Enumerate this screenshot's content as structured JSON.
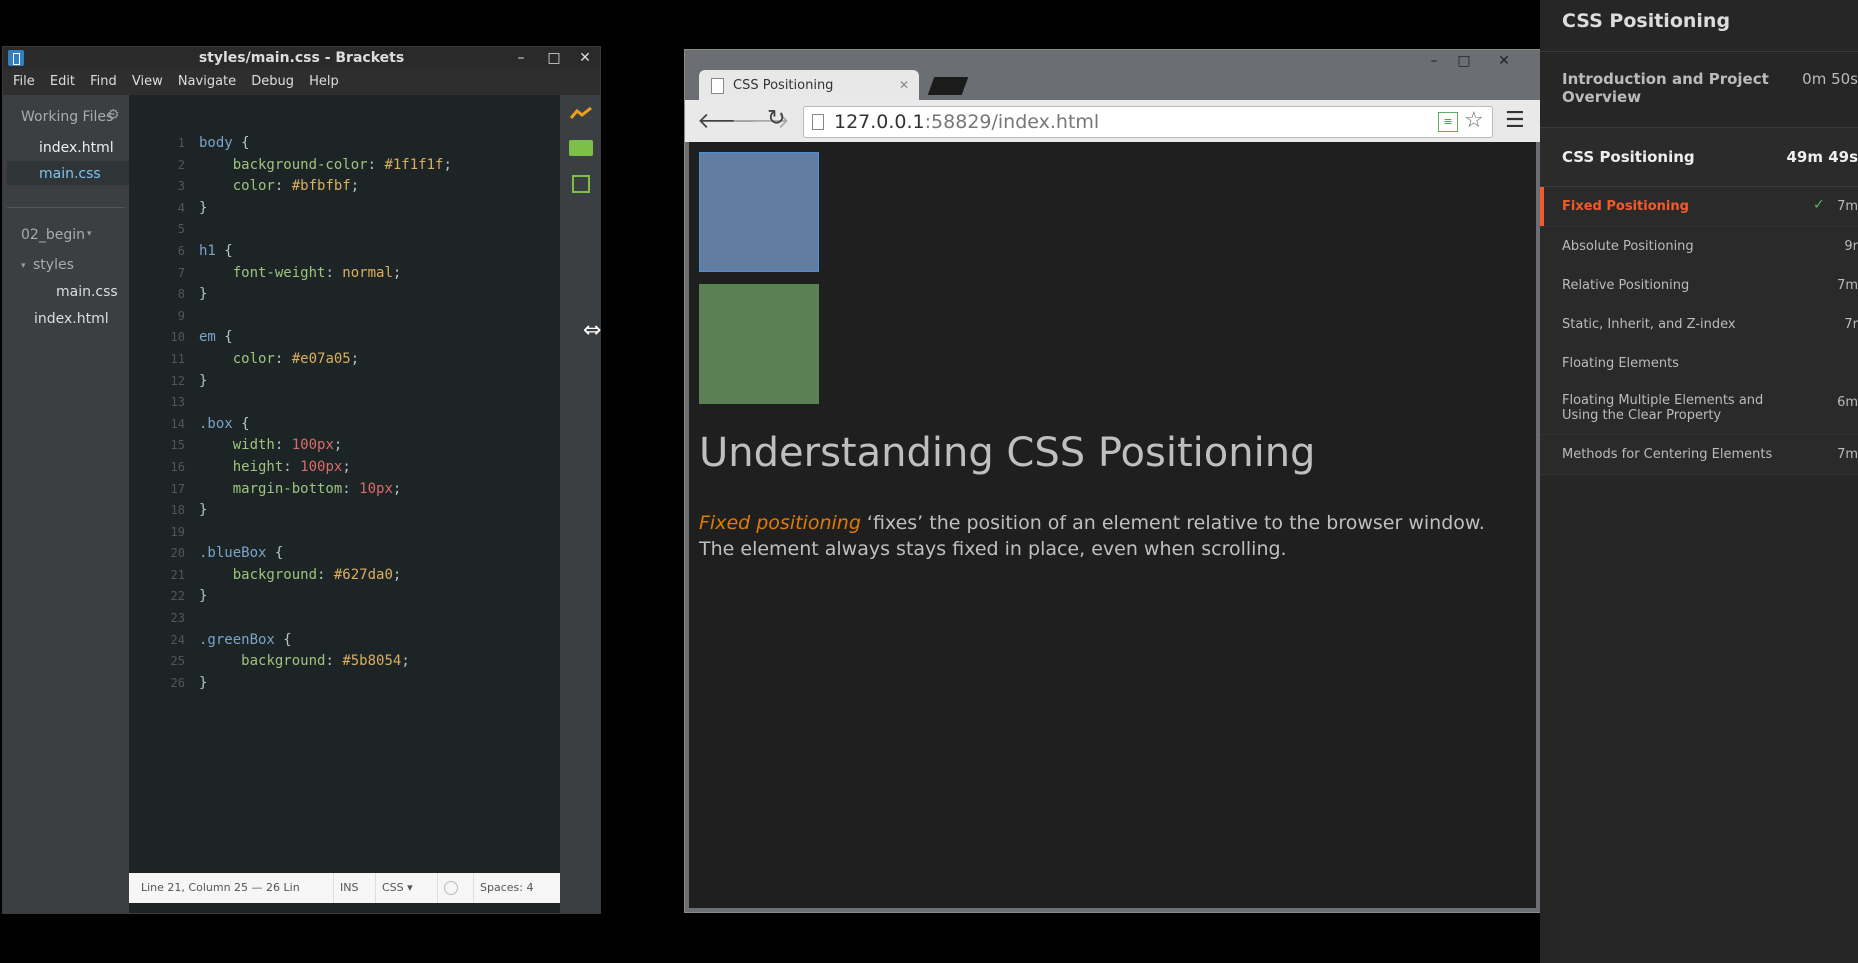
{
  "brackets": {
    "title": "styles/main.css - Brackets",
    "menu": [
      "File",
      "Edit",
      "Find",
      "View",
      "Navigate",
      "Debug",
      "Help"
    ],
    "working_files_label": "Working Files",
    "working_files": [
      "index.html",
      "main.css"
    ],
    "active_file": "main.css",
    "project_label": "02_begin",
    "tree": {
      "folder": "styles",
      "folder_files": [
        "main.css"
      ],
      "root_files": [
        "index.html"
      ]
    },
    "code_lines": [
      "body {",
      "    background-color: #1f1f1f;",
      "    color: #bfbfbf;",
      "}",
      "",
      "h1 {",
      "    font-weight: normal;",
      "}",
      "",
      "em {",
      "    color: #e07a05;",
      "}",
      "",
      ".box {",
      "    width: 100px;",
      "    height: 100px;",
      "    margin-bottom: 10px;",
      "}",
      "",
      ".blueBox {",
      "    background: #627da0;",
      "}",
      "",
      ".greenBox {",
      "     background: #5b8054;",
      "}"
    ],
    "status": {
      "position": "Line 21, Column 25 — 26 Lin",
      "mode": "INS",
      "language": "CSS",
      "spaces": "Spaces: 4"
    }
  },
  "browser": {
    "tab_title": "CSS Positioning",
    "url_host": "127.0.0.1",
    "url_rest": ":58829/index.html",
    "page": {
      "heading": "Understanding CSS Positioning",
      "para_em": "Fixed positioning",
      "para_rest": " ‘fixes’ the position of an element relative to the browser window. The element always stays fixed in place, even when scrolling.",
      "blue_color": "#627da0",
      "green_color": "#5b8054"
    }
  },
  "course": {
    "title": "CSS Positioning",
    "sections": [
      {
        "title": "Introduction and Project Overview",
        "time": "0m 50s"
      },
      {
        "title": "CSS Positioning",
        "time": "49m 49s"
      }
    ],
    "clips": [
      {
        "title": "Fixed Positioning",
        "time": "7m",
        "active": true
      },
      {
        "title": "Absolute Positioning",
        "time": "9r"
      },
      {
        "title": "Relative Positioning",
        "time": "7m"
      },
      {
        "title": "Static, Inherit, and Z-index",
        "time": "7r"
      },
      {
        "title": "Floating Elements",
        "time": ""
      },
      {
        "title": "Floating Multiple Elements and Using the Clear Property",
        "time": "6m"
      },
      {
        "title": "Methods for Centering Elements",
        "time": "7m"
      }
    ],
    "accent": "#f15b2a"
  }
}
